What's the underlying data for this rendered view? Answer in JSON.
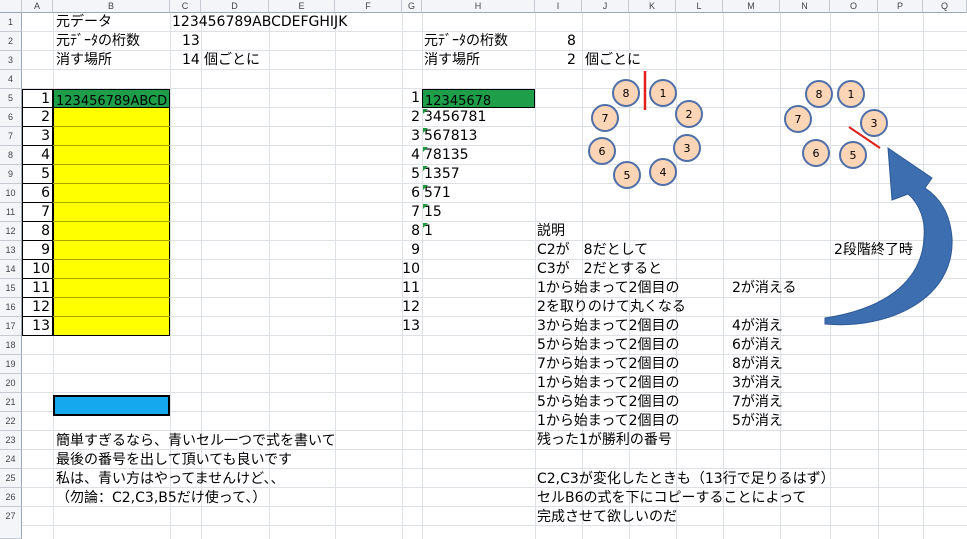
{
  "columns": [
    "A",
    "B",
    "C",
    "D",
    "E",
    "F",
    "G",
    "H",
    "I",
    "J",
    "K",
    "L",
    "M",
    "N",
    "O",
    "P",
    "Q"
  ],
  "rows": [
    "1",
    "2",
    "3",
    "4",
    "5",
    "6",
    "7",
    "8",
    "9",
    "10",
    "11",
    "12",
    "13",
    "14",
    "15",
    "16",
    "17",
    "18",
    "19",
    "20",
    "21",
    "22",
    "23",
    "24",
    "25",
    "26",
    "27"
  ],
  "left": {
    "r1_label": "元データ",
    "r1_value": "123456789ABCDEFGHIJK",
    "r2_label": "元ﾃﾞｰﾀの桁数",
    "r2_value": "13",
    "r3_label": "消す場所",
    "r3_value": "14",
    "r3_suffix": "個ごとに",
    "b5_value": "123456789ABCD",
    "a_numbers": [
      "1",
      "2",
      "3",
      "4",
      "5",
      "6",
      "7",
      "8",
      "9",
      "10",
      "11",
      "12",
      "13"
    ]
  },
  "right": {
    "r2_label": "元ﾃﾞｰﾀの桁数",
    "r2_value": "8",
    "r3_label": "消す場所",
    "r3_value": "2",
    "r3_suffix": "個ごとに",
    "g_numbers": [
      "1",
      "2",
      "3",
      "4",
      "5",
      "6",
      "7",
      "8",
      "9",
      "10",
      "11",
      "12",
      "13"
    ],
    "h_values": [
      "12345678",
      "3456781",
      "567813",
      "78135",
      "1357",
      "571",
      "15",
      "1"
    ]
  },
  "explanation": {
    "title": "説明",
    "lines": [
      {
        "a": "C2が　8だとして",
        "b": ""
      },
      {
        "a": "C3が　2だとすると",
        "b": ""
      },
      {
        "a": "1から始まって2個目の",
        "b": "2が消える"
      },
      {
        "a": "2を取りのけて丸くなる",
        "b": ""
      },
      {
        "a": "3から始まって2個目の",
        "b": "4が消え"
      },
      {
        "a": "5から始まって2個目の",
        "b": "6が消え"
      },
      {
        "a": "7から始まって2個目の",
        "b": "8が消え"
      },
      {
        "a": "1から始まって2個目の",
        "b": "3が消え"
      },
      {
        "a": "5から始まって2個目の",
        "b": "7が消え"
      },
      {
        "a": "1から始まって2個目の",
        "b": "5が消え"
      },
      {
        "a": "残った1が勝利の番号",
        "b": ""
      }
    ],
    "stage_label": "2段階終了時",
    "note1": "C2,C3が変化したときも（13行で足りるはず）",
    "note2": "セルB6の式を下にコピーすることによって",
    "note3": "完成させて欲しいのだ"
  },
  "bottom_notes": [
    "簡単すぎるなら、青いセル一つで式を書いて",
    "最後の番号を出して頂いても良いです",
    "私は、青い方はやってませんけど、、",
    "（勿論：C2,C3,B5だけ使って、）"
  ],
  "circle1": [
    "8",
    "1",
    "2",
    "3",
    "4",
    "5",
    "6",
    "7"
  ],
  "circle2": [
    "8",
    "1",
    "3",
    "5",
    "6",
    "7"
  ],
  "colors": {
    "green": "#1f9e4a",
    "yellow": "#ffff00",
    "blue": "#16a8ee",
    "circle_fill": "#fbd5b5",
    "circle_stroke": "#4f6fa8",
    "arrow": "#3d6eb0",
    "red": "#e0201a"
  }
}
